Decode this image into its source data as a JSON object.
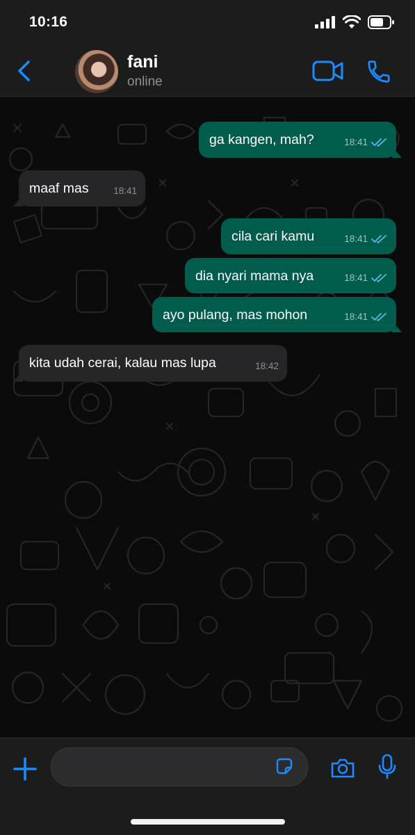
{
  "status_bar": {
    "time": "10:16"
  },
  "header": {
    "contact_name": "fani",
    "contact_status": "online"
  },
  "messages": [
    {
      "direction": "outgoing",
      "text": "ga kangen, mah?",
      "time": "18:41",
      "read": true
    },
    {
      "direction": "incoming",
      "text": "maaf mas",
      "time": "18:41"
    },
    {
      "direction": "outgoing",
      "text": "cila cari kamu",
      "time": "18:41",
      "read": true
    },
    {
      "direction": "outgoing",
      "text": "dia nyari mama nya",
      "time": "18:41",
      "read": true
    },
    {
      "direction": "outgoing",
      "text": "ayo pulang, mas mohon",
      "time": "18:41",
      "read": true
    },
    {
      "direction": "incoming",
      "text": "kita udah cerai, kalau mas lupa",
      "time": "18:42"
    }
  ],
  "composer": {
    "placeholder": ""
  },
  "icons": {
    "back": "chevron-left-icon",
    "video": "video-camera-icon",
    "call": "phone-icon",
    "plus": "plus-icon",
    "sticker": "sticker-icon",
    "camera": "camera-icon",
    "mic": "microphone-icon"
  },
  "colors": {
    "accent": "#1a8cff",
    "outgoing_bubble": "#005c4b",
    "incoming_bubble": "#262628",
    "read_ticks": "#53bdeb"
  }
}
